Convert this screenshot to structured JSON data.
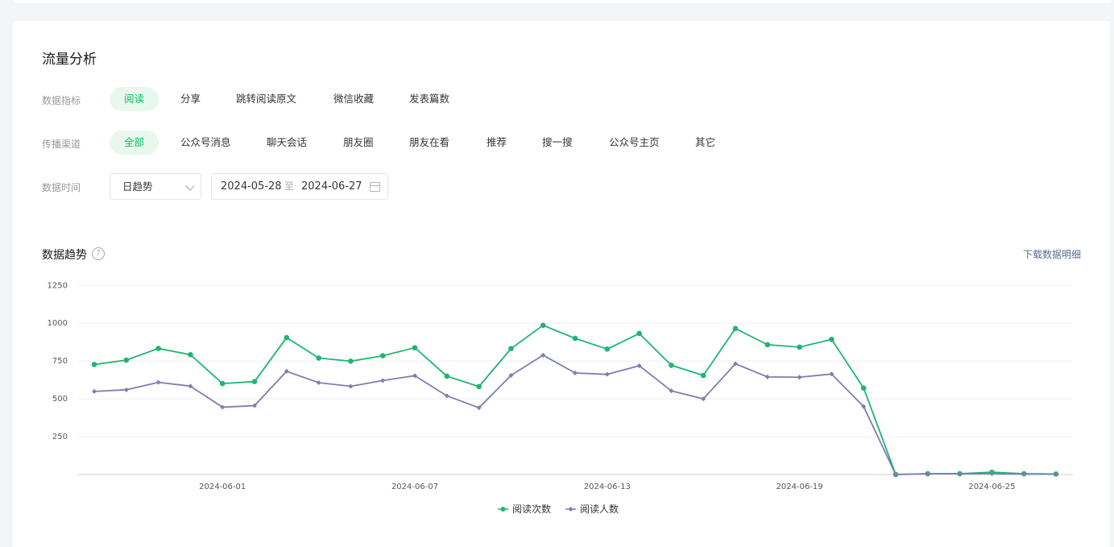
{
  "page": {
    "title": "流量分析",
    "metric_row": {
      "label": "数据指标",
      "options": [
        "阅读",
        "分享",
        "跳转阅读原文",
        "微信收藏",
        "发表篇数"
      ],
      "selected": "阅读"
    },
    "channel_row": {
      "label": "传播渠道",
      "options": [
        "全部",
        "公众号消息",
        "聊天会话",
        "朋友圈",
        "朋友在看",
        "推荐",
        "搜一搜",
        "公众号主页",
        "其它"
      ],
      "selected": "全部"
    },
    "time_row": {
      "label": "数据时间",
      "granularity": "日趋势",
      "start_date": "2024-05-28",
      "separator": "至",
      "end_date": "2024-06-27"
    },
    "trend": {
      "title": "数据趋势",
      "help": "?",
      "download": "下载数据明细"
    }
  },
  "colors": {
    "accent": "#07c160",
    "series1": "#1fb66f",
    "series2": "#7b7fb1",
    "link": "#576b95"
  },
  "icons": {
    "help": "question-circle-icon",
    "calendar": "calendar-icon",
    "chevron": "chevron-down-icon"
  },
  "chart_data": {
    "type": "line",
    "x": [
      "2024-05-28",
      "2024-05-29",
      "2024-05-30",
      "2024-05-31",
      "2024-06-01",
      "2024-06-02",
      "2024-06-03",
      "2024-06-04",
      "2024-06-05",
      "2024-06-06",
      "2024-06-07",
      "2024-06-08",
      "2024-06-09",
      "2024-06-10",
      "2024-06-11",
      "2024-06-12",
      "2024-06-13",
      "2024-06-14",
      "2024-06-15",
      "2024-06-16",
      "2024-06-17",
      "2024-06-18",
      "2024-06-19",
      "2024-06-20",
      "2024-06-21",
      "2024-06-22",
      "2024-06-23",
      "2024-06-24",
      "2024-06-25",
      "2024-06-26",
      "2024-06-27"
    ],
    "x_ticks": [
      "2024-06-01",
      "2024-06-07",
      "2024-06-13",
      "2024-06-19",
      "2024-06-25"
    ],
    "y_ticks": [
      250,
      500,
      750,
      1000,
      1250
    ],
    "ylim": [
      0,
      1250
    ],
    "grid": true,
    "legend_position": "bottom",
    "series": [
      {
        "name": "阅读次数",
        "marker": "circle",
        "values": [
          727,
          756,
          833,
          792,
          601,
          614,
          905,
          770,
          749,
          785,
          838,
          650,
          581,
          832,
          986,
          900,
          829,
          932,
          722,
          655,
          965,
          858,
          842,
          893,
          571,
          0,
          5,
          5,
          15,
          5,
          3
        ]
      },
      {
        "name": "阅读人数",
        "marker": "diamond",
        "values": [
          549,
          560,
          609,
          584,
          445,
          455,
          682,
          607,
          583,
          621,
          653,
          520,
          441,
          655,
          789,
          671,
          662,
          719,
          553,
          500,
          732,
          645,
          643,
          664,
          449,
          0,
          5,
          5,
          5,
          3,
          2
        ]
      }
    ]
  }
}
